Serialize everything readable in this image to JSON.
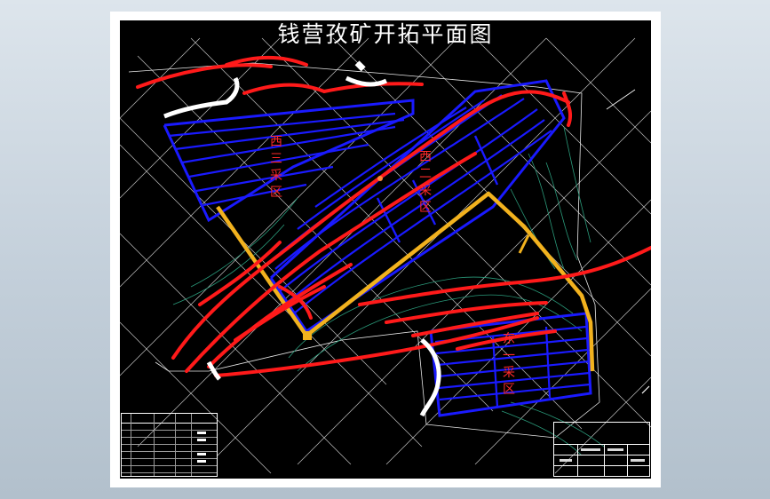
{
  "drawing": {
    "title": "钱营孜矿开拓平面图",
    "zones": {
      "west3": "西三采区",
      "west2": "西二采区",
      "east": "东一采区"
    }
  },
  "colors": {
    "background": "#000000",
    "mining_panels": "#1a1aff",
    "faults": "#ff1a1a",
    "main_roadway": "#f2b21e",
    "contours": "#2a9a7a",
    "grid": "#ffffff"
  }
}
